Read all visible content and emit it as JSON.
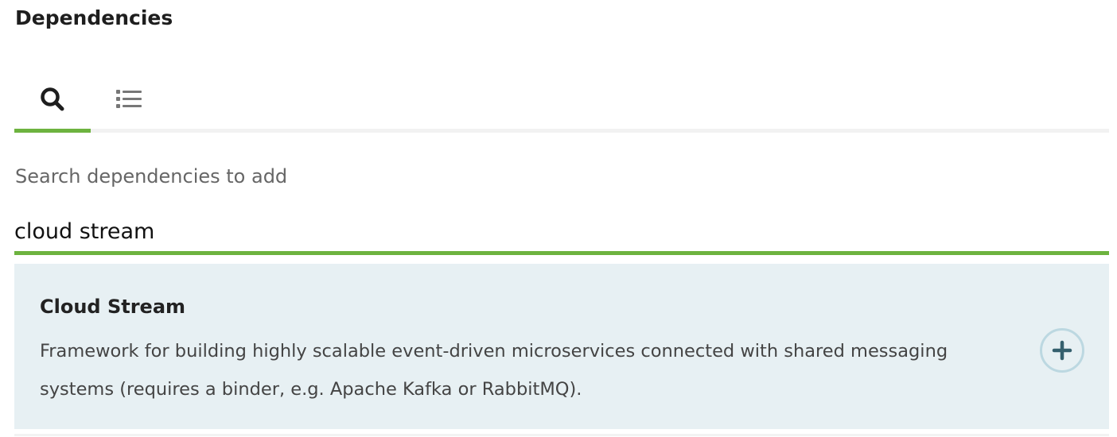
{
  "section": {
    "title": "Dependencies"
  },
  "tabs": [
    {
      "name": "search",
      "icon": "search-icon"
    },
    {
      "name": "list",
      "icon": "list-icon"
    }
  ],
  "search": {
    "label": "Search dependencies to add",
    "value": "cloud stream"
  },
  "results": [
    {
      "name": "Cloud Stream",
      "description": "Framework for building highly scalable event-driven microservices connected with shared messaging systems (requires a binder, e.g. Apache Kafka or RabbitMQ).",
      "action_icon": "plus-icon"
    }
  ],
  "colors": {
    "accent": "#6db33f",
    "result_bg": "#e7f0f3",
    "add_icon": "#35606e"
  }
}
